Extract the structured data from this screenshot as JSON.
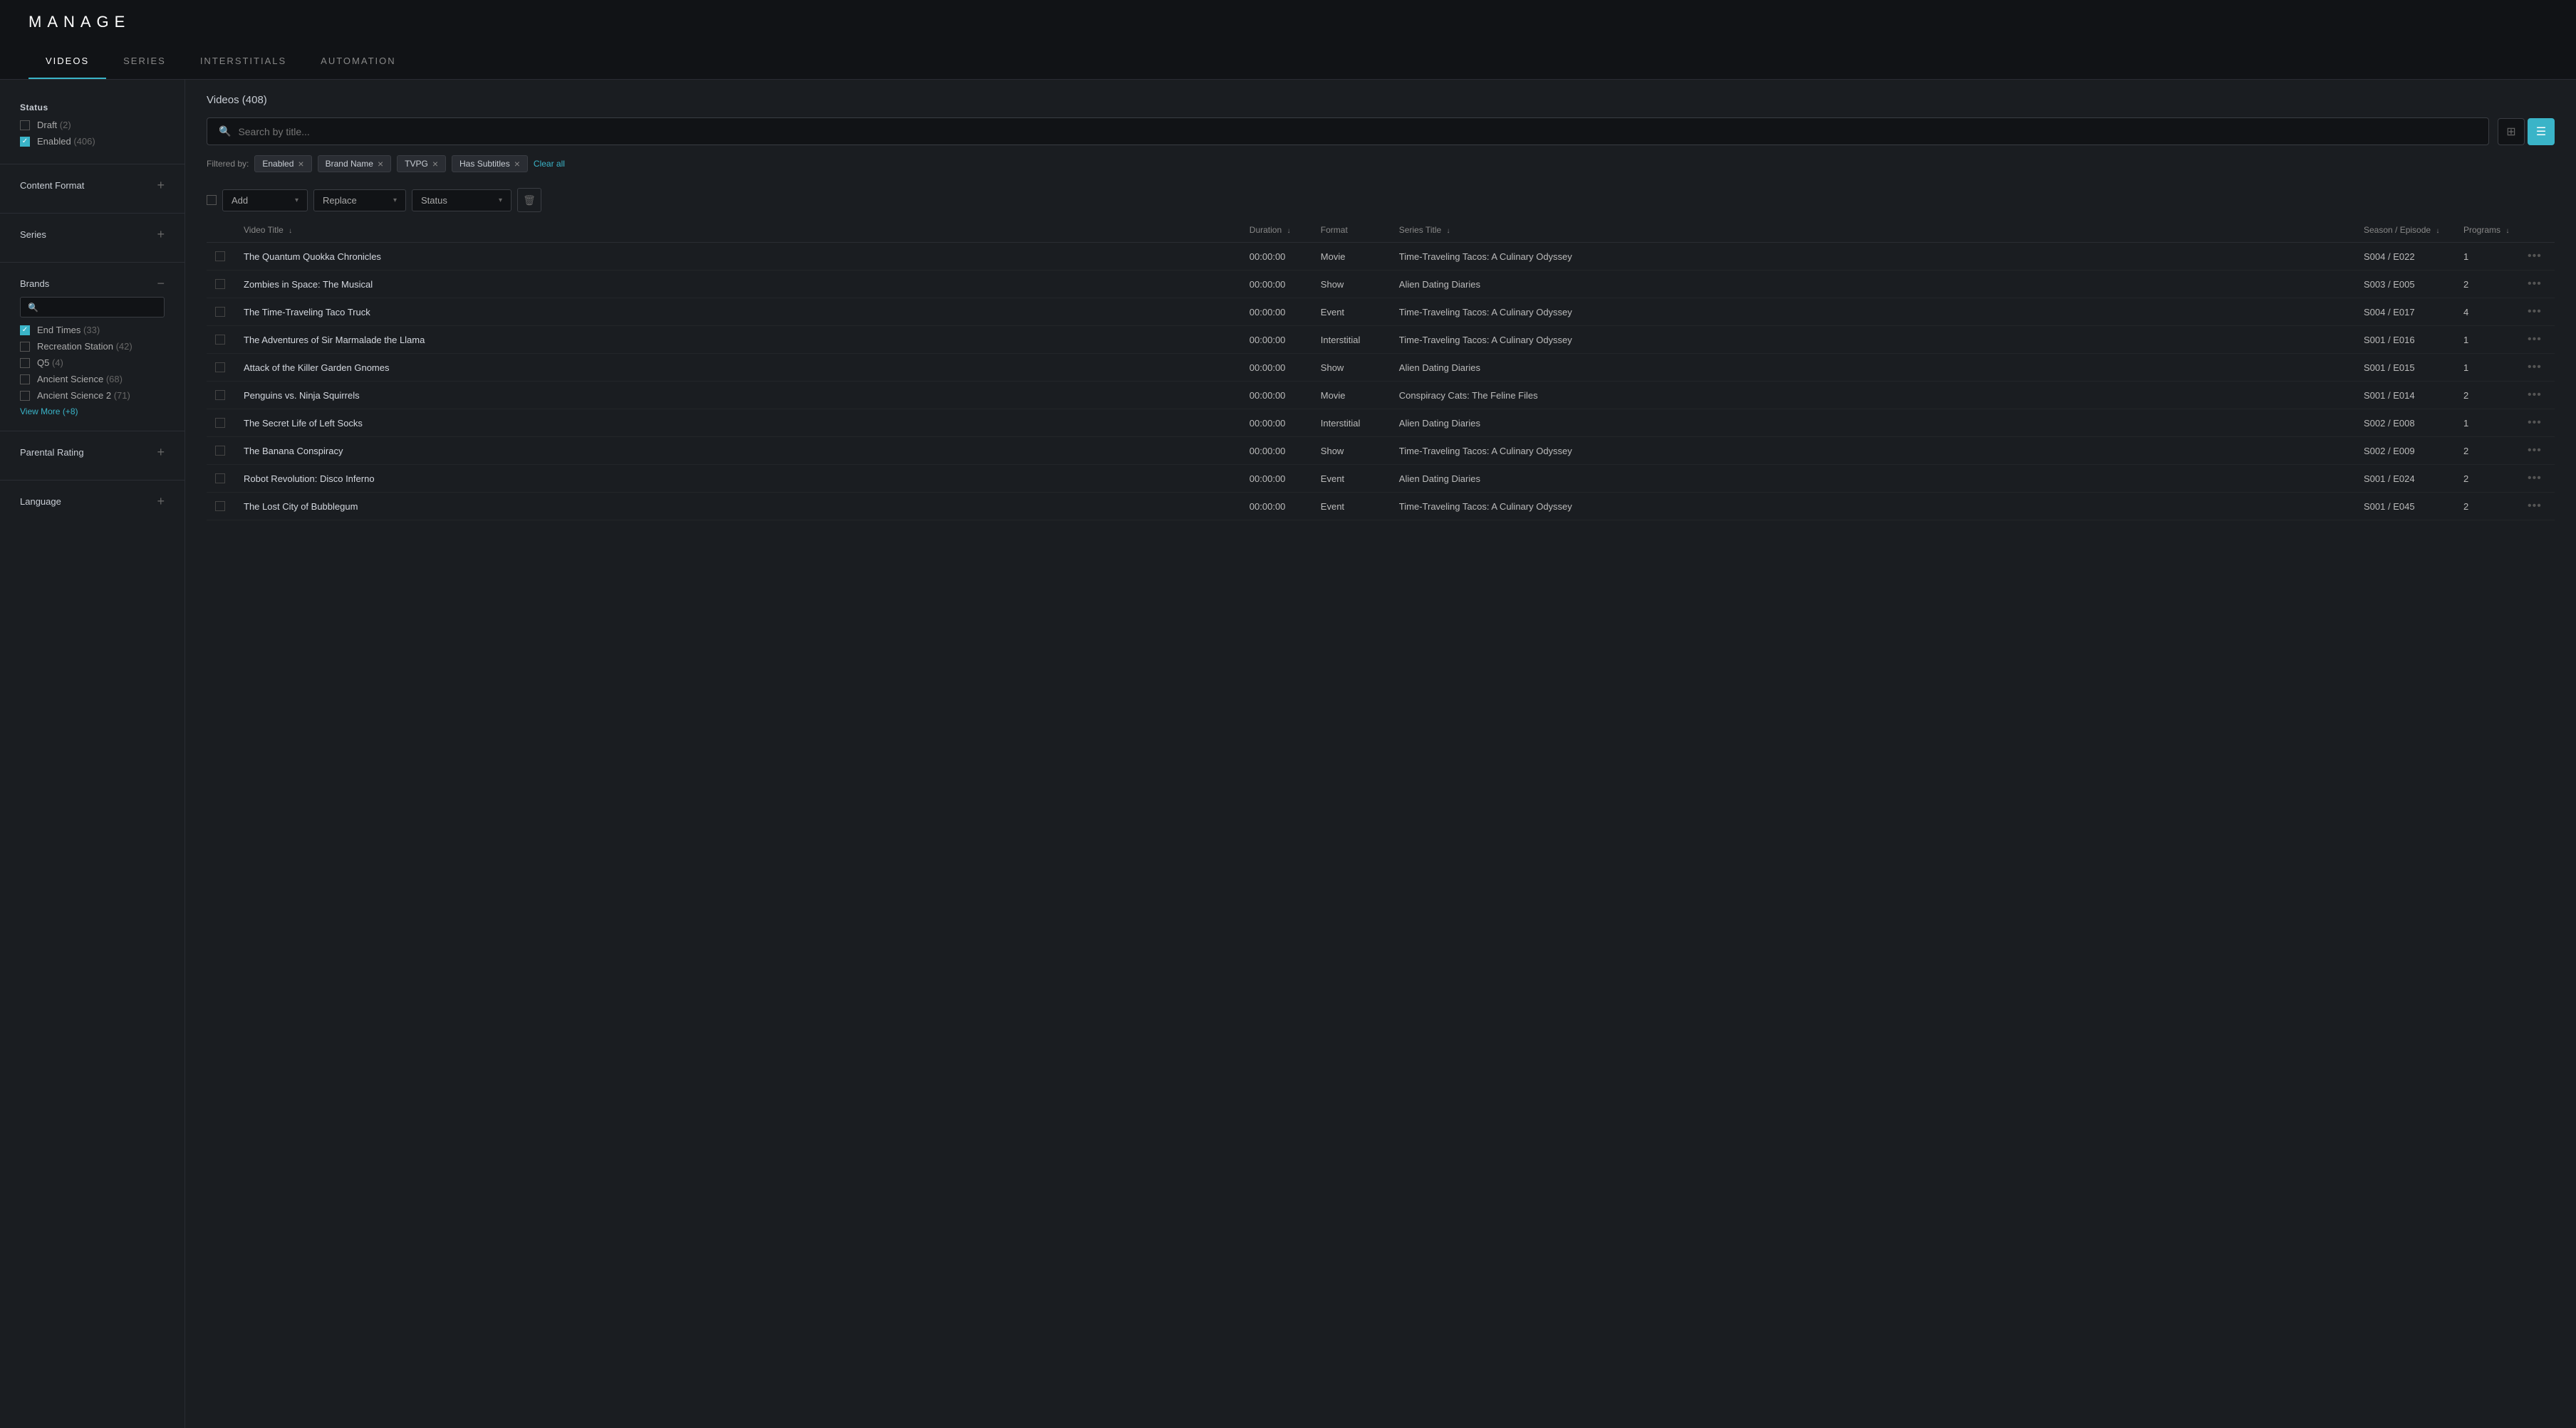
{
  "app": {
    "title": "MANAGE"
  },
  "tabs": [
    {
      "id": "videos",
      "label": "VIDEOS",
      "active": true
    },
    {
      "id": "series",
      "label": "SERIES",
      "active": false
    },
    {
      "id": "interstitials",
      "label": "INTERSTITIALS",
      "active": false
    },
    {
      "id": "automation",
      "label": "AUTOMATION",
      "active": false
    }
  ],
  "sidebar": {
    "status_label": "Status",
    "status_items": [
      {
        "label": "Draft",
        "count": "(2)",
        "checked": false
      },
      {
        "label": "Enabled",
        "count": "(406)",
        "checked": true
      }
    ],
    "content_format_label": "Content Format",
    "series_label": "Series",
    "brands_label": "Brands",
    "brands_search_placeholder": "",
    "brands_items": [
      {
        "label": "End Times",
        "count": "(33)",
        "checked": true
      },
      {
        "label": "Recreation Station",
        "count": "(42)",
        "checked": false
      },
      {
        "label": "Q5",
        "count": "(4)",
        "checked": false
      },
      {
        "label": "Ancient Science",
        "count": "(68)",
        "checked": false
      },
      {
        "label": "Ancient Science 2",
        "count": "(71)",
        "checked": false
      }
    ],
    "view_more_label": "View More",
    "view_more_count": "(+8)",
    "parental_rating_label": "Parental Rating",
    "language_label": "Language"
  },
  "content": {
    "videos_count_label": "Videos (408)",
    "search_placeholder": "Search by title...",
    "view_grid_label": "grid",
    "view_list_label": "list",
    "filter_by_label": "Filtered by:",
    "filters": [
      {
        "label": "Enabled",
        "id": "enabled"
      },
      {
        "label": "Brand Name",
        "id": "brand-name"
      },
      {
        "label": "TVPG",
        "id": "tvpg"
      },
      {
        "label": "Has Subtitles",
        "id": "has-subtitles"
      }
    ],
    "clear_all_label": "Clear all",
    "toolbar": {
      "add_label": "Add",
      "replace_label": "Replace",
      "status_label": "Status"
    },
    "table": {
      "columns": [
        {
          "id": "title",
          "label": "Video Title",
          "sortable": true
        },
        {
          "id": "duration",
          "label": "Duration",
          "sortable": true
        },
        {
          "id": "format",
          "label": "Format",
          "sortable": false
        },
        {
          "id": "series_title",
          "label": "Series Title",
          "sortable": true
        },
        {
          "id": "season_episode",
          "label": "Season / Episode",
          "sortable": true
        },
        {
          "id": "programs",
          "label": "Programs",
          "sortable": true
        }
      ],
      "rows": [
        {
          "title": "The Quantum Quokka Chronicles",
          "duration": "00:00:00",
          "format": "Movie",
          "series_title": "Time-Traveling Tacos: A Culinary Odyssey",
          "season_episode": "S004 / E022",
          "programs": "1"
        },
        {
          "title": "Zombies in Space: The Musical",
          "duration": "00:00:00",
          "format": "Show",
          "series_title": "Alien Dating Diaries",
          "season_episode": "S003 / E005",
          "programs": "2"
        },
        {
          "title": "The Time-Traveling Taco Truck",
          "duration": "00:00:00",
          "format": "Event",
          "series_title": "Time-Traveling Tacos: A Culinary Odyssey",
          "season_episode": "S004 / E017",
          "programs": "4"
        },
        {
          "title": "The Adventures of Sir Marmalade the Llama",
          "duration": "00:00:00",
          "format": "Interstitial",
          "series_title": "Time-Traveling Tacos: A Culinary Odyssey",
          "season_episode": "S001 / E016",
          "programs": "1"
        },
        {
          "title": "Attack of the Killer Garden Gnomes",
          "duration": "00:00:00",
          "format": "Show",
          "series_title": "Alien Dating Diaries",
          "season_episode": "S001 / E015",
          "programs": "1"
        },
        {
          "title": "Penguins vs. Ninja Squirrels",
          "duration": "00:00:00",
          "format": "Movie",
          "series_title": "Conspiracy Cats: The Feline Files",
          "season_episode": "S001 / E014",
          "programs": "2"
        },
        {
          "title": "The Secret Life of Left Socks",
          "duration": "00:00:00",
          "format": "Interstitial",
          "series_title": "Alien Dating Diaries",
          "season_episode": "S002 / E008",
          "programs": "1"
        },
        {
          "title": "The Banana Conspiracy",
          "duration": "00:00:00",
          "format": "Show",
          "series_title": "Time-Traveling Tacos: A Culinary Odyssey",
          "season_episode": "S002 / E009",
          "programs": "2"
        },
        {
          "title": "Robot Revolution: Disco Inferno",
          "duration": "00:00:00",
          "format": "Event",
          "series_title": "Alien Dating Diaries",
          "season_episode": "S001 / E024",
          "programs": "2"
        },
        {
          "title": "The Lost City of Bubblegum",
          "duration": "00:00:00",
          "format": "Event",
          "series_title": "Time-Traveling Tacos: A Culinary Odyssey",
          "season_episode": "S001 / E045",
          "programs": "2"
        }
      ]
    }
  },
  "colors": {
    "accent": "#3ab4c8",
    "bg_dark": "#111316",
    "bg_main": "#1a1d21",
    "border": "#2a2d33"
  }
}
